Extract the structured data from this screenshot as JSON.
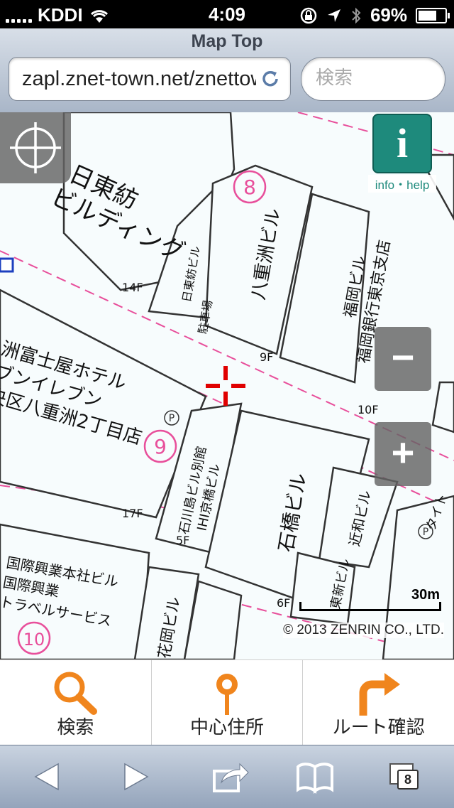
{
  "status_bar": {
    "carrier": "KDDI",
    "time": "4:09",
    "battery": "69%",
    "battery_level": 0.69
  },
  "browser": {
    "page_title": "Map Top",
    "url": "zapl.znet-town.net/znettown",
    "search_placeholder": "検索"
  },
  "map": {
    "labels": {
      "bldg_nittobo": [
        "日東紡",
        "ビルディング"
      ],
      "floors": [
        "14F",
        "9F",
        "17F",
        "5F",
        "6F",
        "10F"
      ],
      "circle_numbers": [
        "8",
        "9",
        "10"
      ],
      "bldg_hotel": [
        "洲富士屋ホテル",
        "ブンイレブン",
        "央区八重洲2丁目店"
      ],
      "bldg_yaesu": [
        "八重洲ビル"
      ],
      "bldg_nittobo_small": [
        "日東紡ビル",
        "駐車場"
      ],
      "bldg_fukuoka": [
        "福岡ビル",
        "福岡銀行東京支店"
      ],
      "bldg_ishibashi": [
        "石橋ビル"
      ],
      "bldg_ihi": [
        "IHI京橋ビル",
        "石川島ビル別館"
      ],
      "bldg_kokusai": [
        "国際興業本社ビル",
        "国際興業",
        "トラベルサービス"
      ],
      "bldg_kawa": [
        "花岡ビル"
      ],
      "bldg_chikawa": [
        "近和ビル"
      ],
      "bldg_higashi": [
        "東新ビル"
      ],
      "bldg_taito": [
        "タイト"
      ],
      "parking": "P"
    },
    "info_label": "info・help",
    "info_icon": "i",
    "zoom_out": "−",
    "zoom_in": "+",
    "scale_label": "30m",
    "copyright": "© 2013 ZENRIN CO., LTD."
  },
  "app_tabs": [
    {
      "label": "検索",
      "icon": "magnifier-icon"
    },
    {
      "label": "中心住所",
      "icon": "map-pin-icon"
    },
    {
      "label": "ルート確認",
      "icon": "turn-right-arrow-icon"
    }
  ],
  "toolbar": {
    "tabs_count": "8"
  },
  "colors": {
    "accent_orange": "#f0851d",
    "info_teal": "#1e8a7c",
    "map_pink": "#e84f9b",
    "crosshair_red": "#e00000"
  }
}
